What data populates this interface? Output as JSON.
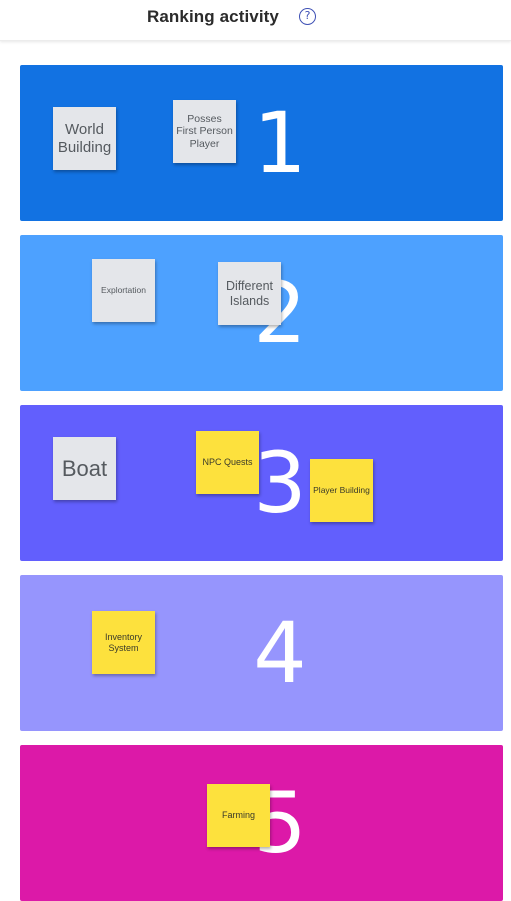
{
  "header": {
    "title": "Ranking activity",
    "help_icon": "question-circle-icon"
  },
  "colors": {
    "rank_1": "#1272e2",
    "rank_2": "#4da1ff",
    "rank_3": "#625ffd",
    "rank_4": "#9695fd",
    "rank_5": "#dc19a8",
    "note_grey": "#e4e6ea",
    "note_yellow": "#fde13d"
  },
  "bands": [
    {
      "rank": "1",
      "notes": [
        {
          "text": "World Building",
          "style": "grey"
        },
        {
          "text": "Posses First Person Player",
          "style": "grey"
        }
      ]
    },
    {
      "rank": "2",
      "notes": [
        {
          "text": "Explortation",
          "style": "grey"
        },
        {
          "text": "Different Islands",
          "style": "grey"
        }
      ]
    },
    {
      "rank": "3",
      "notes": [
        {
          "text": "Boat",
          "style": "grey"
        },
        {
          "text": "NPC Quests",
          "style": "yellow"
        },
        {
          "text": "Player Building",
          "style": "yellow"
        }
      ]
    },
    {
      "rank": "4",
      "notes": [
        {
          "text": "Inventory System",
          "style": "yellow"
        }
      ]
    },
    {
      "rank": "5",
      "notes": [
        {
          "text": "Farming",
          "style": "yellow"
        }
      ]
    }
  ]
}
